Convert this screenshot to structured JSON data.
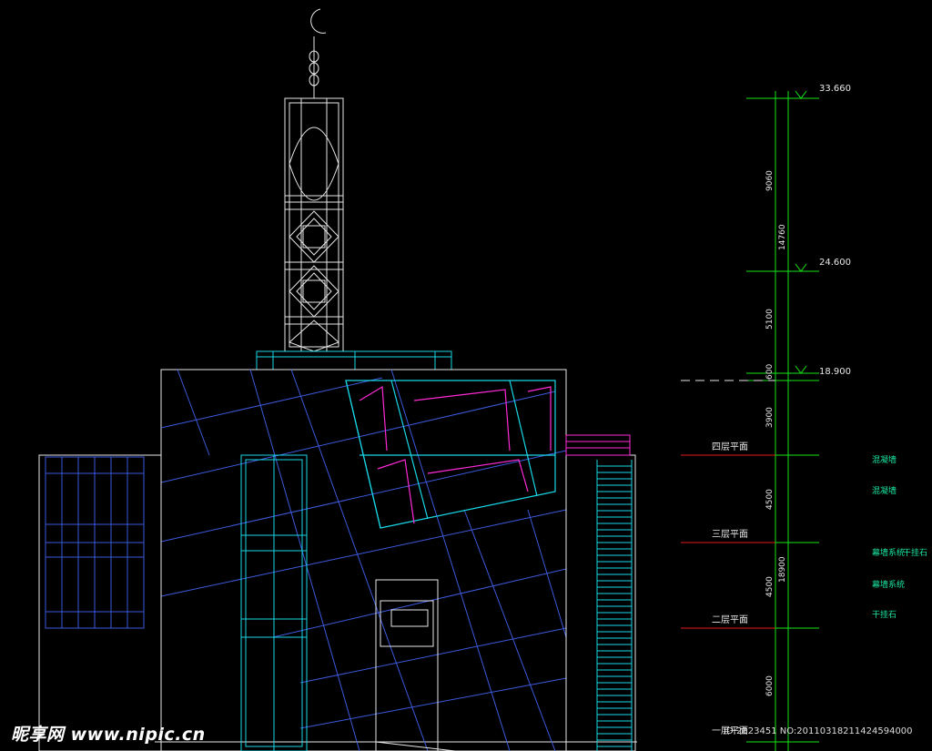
{
  "colors": {
    "background": "#000000",
    "outline": "#e6e6e6",
    "cyan": "#19d6e6",
    "blue": "#3c5adc",
    "magenta": "#ff2bd6",
    "green": "#19e619",
    "red": "#e61919",
    "label_green": "#19e6a0"
  },
  "elevations": [
    {
      "label": "33.660",
      "value": 33.66
    },
    {
      "label": "24.600",
      "value": 24.6
    },
    {
      "label": "18.900",
      "value": 18.9
    }
  ],
  "dimensions": {
    "d9060": "9060",
    "d14760": "14760",
    "d5100": "5100",
    "d600": "600",
    "d3900": "3900",
    "d4500a": "4500",
    "d18900": "18900",
    "d4500b": "4500",
    "d6000": "6000"
  },
  "floors": [
    {
      "label": "四层平面"
    },
    {
      "label": "三层平面"
    },
    {
      "label": "二层平面"
    },
    {
      "label": "一层平面"
    }
  ],
  "notes": [
    "混凝墙",
    "混凝墙",
    "幕墙系统",
    "干挂石",
    "幕墙系统",
    "干挂石"
  ],
  "watermark": {
    "site": "昵享网 www.nipic.cn",
    "id": "ID:2823451 NO:20110318211424594000"
  }
}
